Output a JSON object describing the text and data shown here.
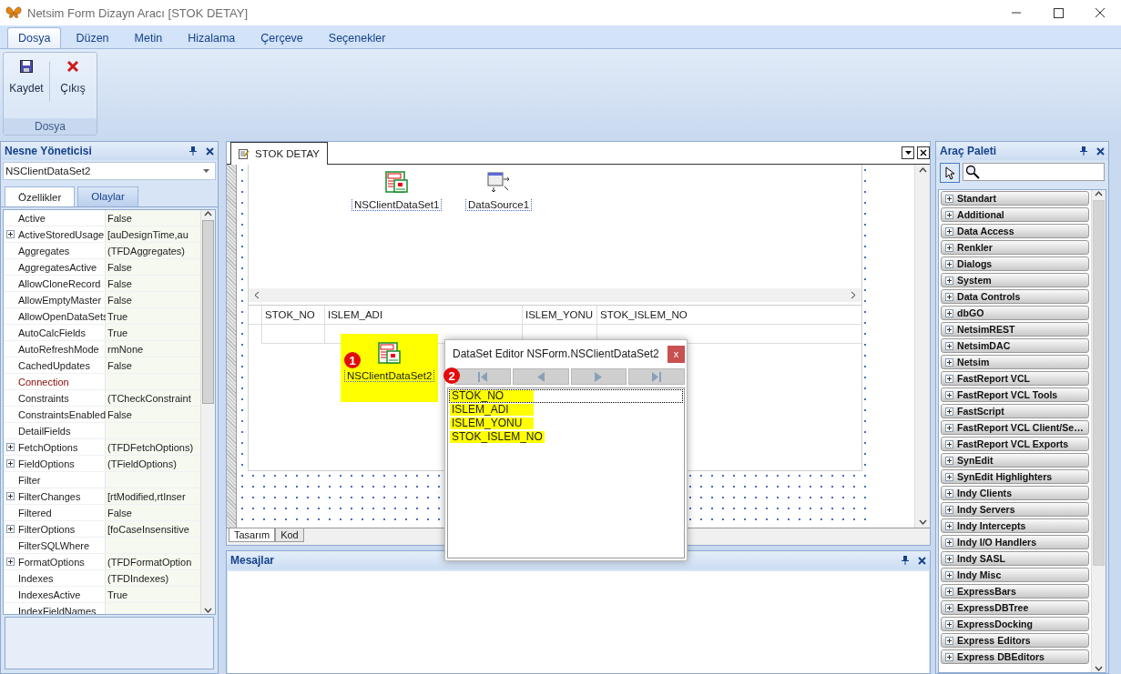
{
  "window": {
    "title": "Netsim Form Dizayn Aracı [STOK DETAY]"
  },
  "ribbon": {
    "tabs": [
      {
        "label": "Dosya",
        "selected": true
      },
      {
        "label": "Düzen",
        "selected": false
      },
      {
        "label": "Metin",
        "selected": false
      },
      {
        "label": "Hizalama",
        "selected": false
      },
      {
        "label": "Çerçeve",
        "selected": false
      },
      {
        "label": "Seçenekler",
        "selected": false
      }
    ],
    "buttons": [
      {
        "label": "Kaydet",
        "kind": "save"
      },
      {
        "label": "Çıkış",
        "kind": "exit"
      }
    ],
    "group_label": "Dosya"
  },
  "object_inspector": {
    "title": "Nesne Yöneticisi",
    "selected_object": "NSClientDataSet2",
    "tabs": [
      {
        "label": "Özellikler",
        "selected": true
      },
      {
        "label": "Olaylar",
        "selected": false
      }
    ],
    "properties": [
      {
        "name": "Active",
        "value": "False",
        "expandable": false,
        "required": false
      },
      {
        "name": "ActiveStoredUsage",
        "value": "[auDesignTime,au",
        "expandable": true,
        "required": false
      },
      {
        "name": "Aggregates",
        "value": "(TFDAggregates)",
        "expandable": false,
        "required": false
      },
      {
        "name": "AggregatesActive",
        "value": "False",
        "expandable": false,
        "required": false
      },
      {
        "name": "AllowCloneRecord",
        "value": "False",
        "expandable": false,
        "required": false
      },
      {
        "name": "AllowEmptyMaster",
        "value": "False",
        "expandable": false,
        "required": false
      },
      {
        "name": "AllowOpenDataSets",
        "value": "True",
        "expandable": false,
        "required": false
      },
      {
        "name": "AutoCalcFields",
        "value": "True",
        "expandable": false,
        "required": false
      },
      {
        "name": "AutoRefreshMode",
        "value": "rmNone",
        "expandable": false,
        "required": false
      },
      {
        "name": "CachedUpdates",
        "value": "False",
        "expandable": false,
        "required": false
      },
      {
        "name": "Connection",
        "expandable": false,
        "required": true
      },
      {
        "name": "Constraints",
        "value": "(TCheckConstraint",
        "expandable": false,
        "required": false
      },
      {
        "name": "ConstraintsEnabled",
        "value": "False",
        "expandable": false,
        "required": false
      },
      {
        "name": "DetailFields",
        "expandable": false,
        "required": false
      },
      {
        "name": "FetchOptions",
        "value": "(TFDFetchOptions)",
        "expandable": true,
        "required": false
      },
      {
        "name": "FieldOptions",
        "value": "(TFieldOptions)",
        "expandable": true,
        "required": false
      },
      {
        "name": "Filter",
        "expandable": false,
        "required": false
      },
      {
        "name": "FilterChanges",
        "value": "[rtModified,rtInser",
        "expandable": true,
        "required": false
      },
      {
        "name": "Filtered",
        "value": "False",
        "expandable": false,
        "required": false
      },
      {
        "name": "FilterOptions",
        "value": "[foCaseInsensitive",
        "expandable": true,
        "required": false
      },
      {
        "name": "FilterSQLWhere",
        "expandable": false,
        "required": false
      },
      {
        "name": "FormatOptions",
        "value": "(TFDFormatOption",
        "expandable": true,
        "required": false
      },
      {
        "name": "Indexes",
        "value": "(TFDIndexes)",
        "expandable": false,
        "required": false
      },
      {
        "name": "IndexesActive",
        "value": "True",
        "expandable": false,
        "required": false
      },
      {
        "name": "IndexFieldNames",
        "expandable": false,
        "required": false
      }
    ]
  },
  "designer": {
    "tab": "STOK DETAY",
    "components": [
      {
        "name": "NSClientDataSet1",
        "kind": "dataset",
        "selected": false
      },
      {
        "name": "DataSource1",
        "kind": "datasource",
        "selected": false
      },
      {
        "name": "NSClientDataSet2",
        "kind": "dataset",
        "selected": true
      }
    ],
    "grid_columns": [
      "STOK_NO",
      "ISLEM_ADI",
      "ISLEM_YONU",
      "STOK_ISLEM_NO"
    ],
    "badge": "1",
    "view_tabs": [
      {
        "label": "Tasarım",
        "selected": true
      },
      {
        "label": "Kod",
        "selected": false
      }
    ]
  },
  "dataset_editor": {
    "title": "DataSet Editor NSForm.NSClientDataSet2",
    "close": "x",
    "badge": "2",
    "fields": [
      {
        "name": "STOK_NO",
        "focused": true,
        "highlighted": true
      },
      {
        "name": "ISLEM_ADI",
        "focused": false,
        "highlighted": true
      },
      {
        "name": "ISLEM_YONU",
        "focused": false,
        "highlighted": true
      },
      {
        "name": "STOK_ISLEM_NO",
        "focused": false,
        "highlighted": true
      }
    ]
  },
  "messages": {
    "title": "Mesajlar"
  },
  "tool_palette": {
    "title": "Araç Paleti",
    "categories": [
      "Standart",
      "Additional",
      "Data Access",
      "Renkler",
      "Dialogs",
      "System",
      "Data Controls",
      "dbGO",
      "NetsimREST",
      "NetsimDAC",
      "Netsim",
      "FastReport VCL",
      "FastReport VCL Tools",
      "FastScript",
      "FastReport VCL Client/Se…",
      "FastReport VCL Exports",
      "SynEdit",
      "SynEdit Highlighters",
      "Indy Clients",
      "Indy Servers",
      "Indy Intercepts",
      "Indy I/O Handlers",
      "Indy SASL",
      "Indy Misc",
      "ExpressBars",
      "ExpressDBTree",
      "ExpressDocking",
      "Express Editors",
      "Express DBEditors"
    ]
  }
}
